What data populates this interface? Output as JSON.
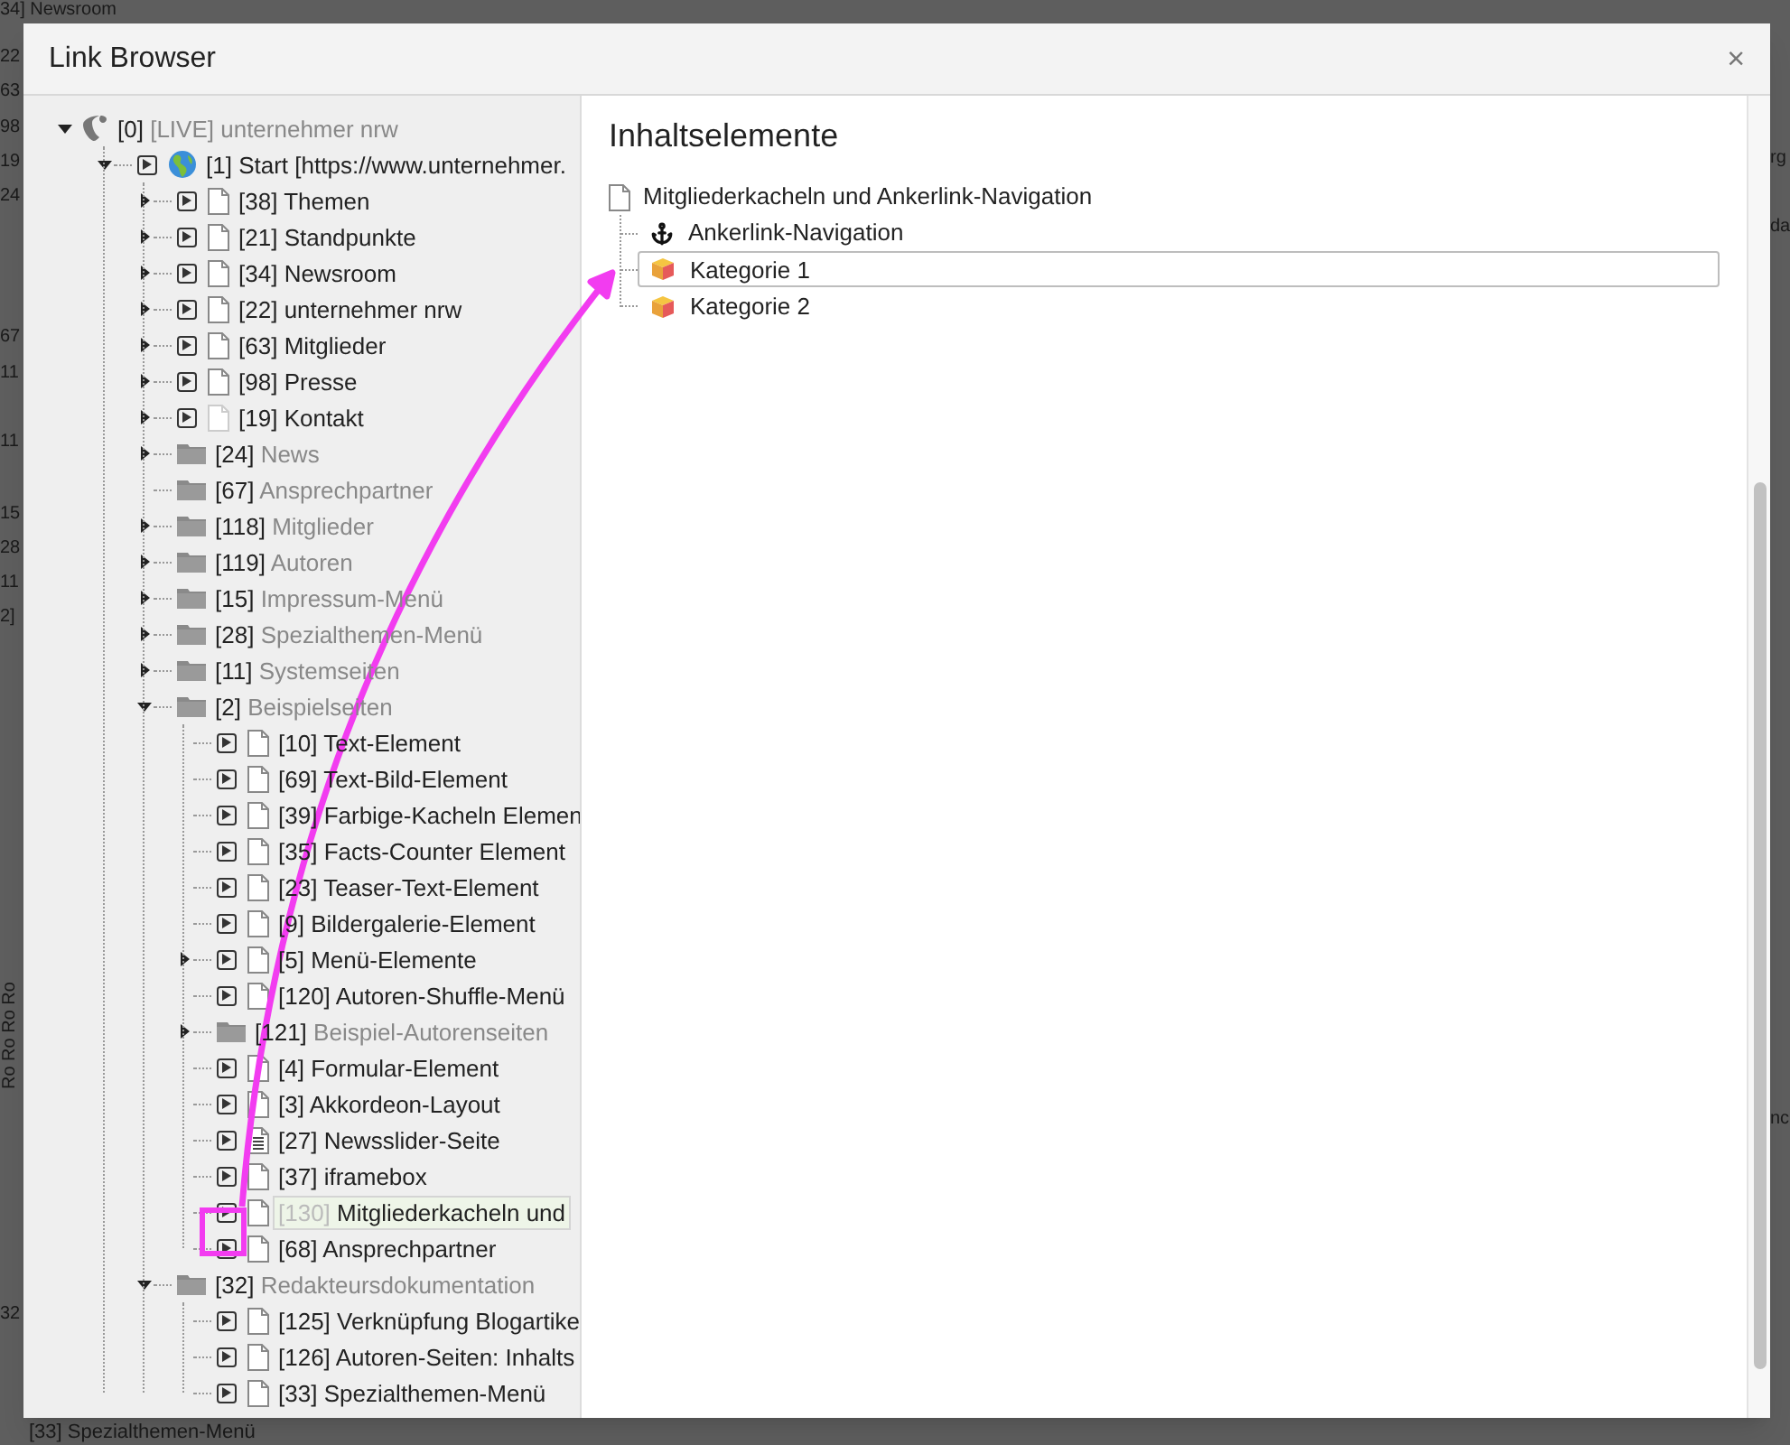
{
  "backdrop": {
    "top_text": "34] Newsroom",
    "left_fragments": [
      "22",
      "63",
      "98",
      "19",
      "24",
      "67",
      "11",
      "11",
      "15",
      "28",
      "11",
      "2]",
      "32"
    ],
    "vertical_text": "Ro Ro Ro Ro",
    "bottom_text": "[33] Spezialthemen-Menü",
    "right_fragments": [
      "rg",
      "da",
      "nc"
    ]
  },
  "dialog": {
    "title": "Link Browser",
    "close": "×"
  },
  "page_tree": [
    {
      "id": "[0]",
      "title": "[LIVE] unternehmer nrw",
      "kind": "root",
      "link": false,
      "expandable": true,
      "expanded": true,
      "selected": false,
      "children": [
        {
          "id": "[1]",
          "title": "Start [https://www.unternehmer.",
          "kind": "site",
          "link": true,
          "expandable": true,
          "expanded": true,
          "selected": false,
          "children": [
            {
              "id": "[38]",
              "title": "Themen",
              "kind": "page",
              "link": true,
              "expandable": true,
              "expanded": false,
              "selected": false
            },
            {
              "id": "[21]",
              "title": "Standpunkte",
              "kind": "page",
              "link": true,
              "expandable": true,
              "expanded": false,
              "selected": false
            },
            {
              "id": "[34]",
              "title": "Newsroom",
              "kind": "page",
              "link": true,
              "expandable": true,
              "expanded": false,
              "selected": false
            },
            {
              "id": "[22]",
              "title": "unternehmer nrw",
              "kind": "page",
              "link": true,
              "expandable": true,
              "expanded": false,
              "selected": false
            },
            {
              "id": "[63]",
              "title": "Mitglieder",
              "kind": "page",
              "link": true,
              "expandable": true,
              "expanded": false,
              "selected": false
            },
            {
              "id": "[98]",
              "title": "Presse",
              "kind": "page",
              "link": true,
              "expandable": true,
              "expanded": false,
              "selected": false
            },
            {
              "id": "[19]",
              "title": "Kontakt",
              "kind": "hidden_page",
              "link": true,
              "expandable": true,
              "expanded": false,
              "selected": false
            },
            {
              "id": "[24]",
              "title": "News",
              "kind": "folder",
              "link": false,
              "expandable": true,
              "expanded": false,
              "selected": false
            },
            {
              "id": "[67]",
              "title": "Ansprechpartner",
              "kind": "folder",
              "link": false,
              "expandable": false,
              "selected": false
            },
            {
              "id": "[118]",
              "title": "Mitglieder",
              "kind": "folder",
              "link": false,
              "expandable": true,
              "expanded": false,
              "selected": false
            },
            {
              "id": "[119]",
              "title": "Autoren",
              "kind": "folder",
              "link": false,
              "expandable": true,
              "expanded": false,
              "selected": false
            },
            {
              "id": "[15]",
              "title": "Impressum-Menü",
              "kind": "folder",
              "link": false,
              "expandable": true,
              "expanded": false,
              "selected": false
            },
            {
              "id": "[28]",
              "title": "Spezialthemen-Menü",
              "kind": "folder",
              "link": false,
              "expandable": true,
              "expanded": false,
              "selected": false
            },
            {
              "id": "[11]",
              "title": "Systemseiten",
              "kind": "folder",
              "link": false,
              "expandable": true,
              "expanded": false,
              "selected": false
            },
            {
              "id": "[2]",
              "title": "Beispielseiten",
              "kind": "folder",
              "link": false,
              "expandable": true,
              "expanded": true,
              "selected": false,
              "children": [
                {
                  "id": "[10]",
                  "title": "Text-Element",
                  "kind": "page",
                  "link": true,
                  "expandable": false,
                  "selected": false
                },
                {
                  "id": "[69]",
                  "title": "Text-Bild-Element",
                  "kind": "page",
                  "link": true,
                  "expandable": false,
                  "selected": false
                },
                {
                  "id": "[39]",
                  "title": "Farbige-Kacheln Elemen",
                  "kind": "page",
                  "link": true,
                  "expandable": false,
                  "selected": false
                },
                {
                  "id": "[35]",
                  "title": "Facts-Counter Element",
                  "kind": "page",
                  "link": true,
                  "expandable": false,
                  "selected": false
                },
                {
                  "id": "[23]",
                  "title": "Teaser-Text-Element",
                  "kind": "page",
                  "link": true,
                  "expandable": false,
                  "selected": false
                },
                {
                  "id": "[9]",
                  "title": "Bildergalerie-Element",
                  "kind": "page",
                  "link": true,
                  "expandable": false,
                  "selected": false
                },
                {
                  "id": "[5]",
                  "title": "Menü-Elemente",
                  "kind": "page",
                  "link": true,
                  "expandable": true,
                  "expanded": false,
                  "selected": false
                },
                {
                  "id": "[120]",
                  "title": "Autoren-Shuffle-Menü",
                  "kind": "page",
                  "link": true,
                  "expandable": false,
                  "selected": false
                },
                {
                  "id": "[121]",
                  "title": "Beispiel-Autorenseiten",
                  "kind": "folder",
                  "link": false,
                  "expandable": true,
                  "expanded": false,
                  "selected": false
                },
                {
                  "id": "[4]",
                  "title": "Formular-Element",
                  "kind": "page",
                  "link": true,
                  "expandable": false,
                  "selected": false
                },
                {
                  "id": "[3]",
                  "title": "Akkordeon-Layout",
                  "kind": "page",
                  "link": true,
                  "expandable": false,
                  "selected": false
                },
                {
                  "id": "[27]",
                  "title": "Newsslider-Seite",
                  "kind": "slider_page",
                  "link": true,
                  "expandable": false,
                  "selected": false
                },
                {
                  "id": "[37]",
                  "title": "iframebox",
                  "kind": "page",
                  "link": true,
                  "expandable": false,
                  "selected": false
                },
                {
                  "id": "[130]",
                  "title": "Mitgliederkacheln und",
                  "kind": "page",
                  "link": true,
                  "expandable": false,
                  "selected": true
                },
                {
                  "id": "[68]",
                  "title": "Ansprechpartner",
                  "kind": "page",
                  "link": true,
                  "expandable": false,
                  "selected": false
                }
              ]
            },
            {
              "id": "[32]",
              "title": "Redakteursdokumentation",
              "kind": "folder",
              "link": false,
              "expandable": true,
              "expanded": true,
              "selected": false,
              "children": [
                {
                  "id": "[125]",
                  "title": "Verknüpfung Blogartike",
                  "kind": "page",
                  "link": true,
                  "expandable": false,
                  "selected": false
                },
                {
                  "id": "[126]",
                  "title": "Autoren-Seiten: Inhalts",
                  "kind": "page",
                  "link": true,
                  "expandable": false,
                  "selected": false
                },
                {
                  "id": "[33]",
                  "title": "Spezialthemen-Menü",
                  "kind": "page",
                  "link": true,
                  "expandable": false,
                  "selected": false
                }
              ]
            }
          ]
        }
      ]
    }
  ],
  "content": {
    "heading": "Inhaltselemente",
    "page_title": "Mitgliederkacheln und Ankerlink-Navigation",
    "elements": [
      {
        "kind": "anchor",
        "title": "Ankerlink-Navigation",
        "selected": false
      },
      {
        "kind": "cube",
        "title": "Kategorie 1",
        "selected": true
      },
      {
        "kind": "cube",
        "title": "Kategorie 2",
        "selected": false
      }
    ]
  }
}
